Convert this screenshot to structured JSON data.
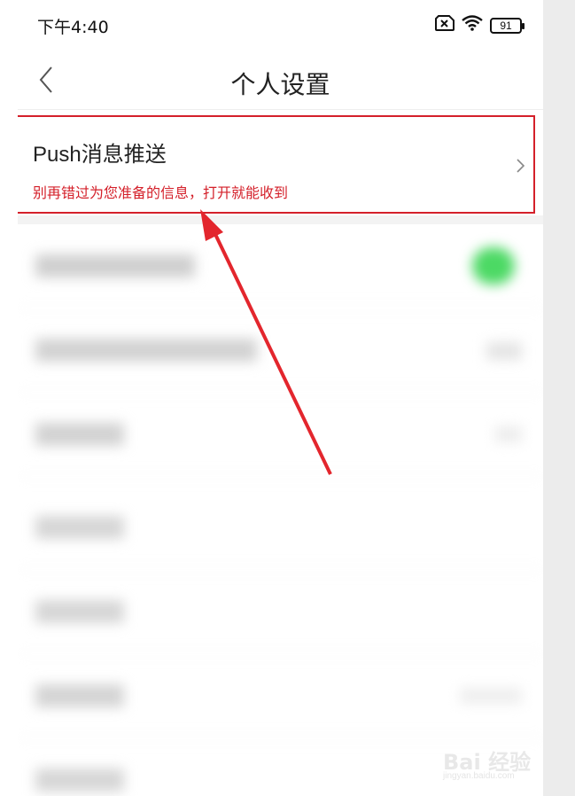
{
  "status_bar": {
    "time": "下午4:40",
    "battery": "91",
    "icons": [
      "sim-disabled-icon",
      "wifi-icon",
      "battery-icon"
    ]
  },
  "nav": {
    "title": "个人设置",
    "back_icon": "back-arrow-icon"
  },
  "push_setting": {
    "title": "Push消息推送",
    "subtitle": "别再错过为您准备的信息，打开就能收到",
    "chevron_icon": "chevron-right-icon",
    "highlight_color": "#d4202a"
  },
  "blurred_rows": [
    {
      "label": "",
      "right": "toggle-on"
    },
    {
      "label": "",
      "right": ""
    },
    {
      "label": "",
      "right": ""
    },
    {
      "label": "",
      "right": ""
    },
    {
      "label": "",
      "right": ""
    },
    {
      "label": "",
      "right": ""
    },
    {
      "label": "",
      "right": ""
    }
  ],
  "colors": {
    "accent_red": "#d4202a",
    "toggle_green": "#4cd964"
  },
  "watermark": {
    "brand": "Bai 经验",
    "url": "jingyan.baidu.com"
  }
}
